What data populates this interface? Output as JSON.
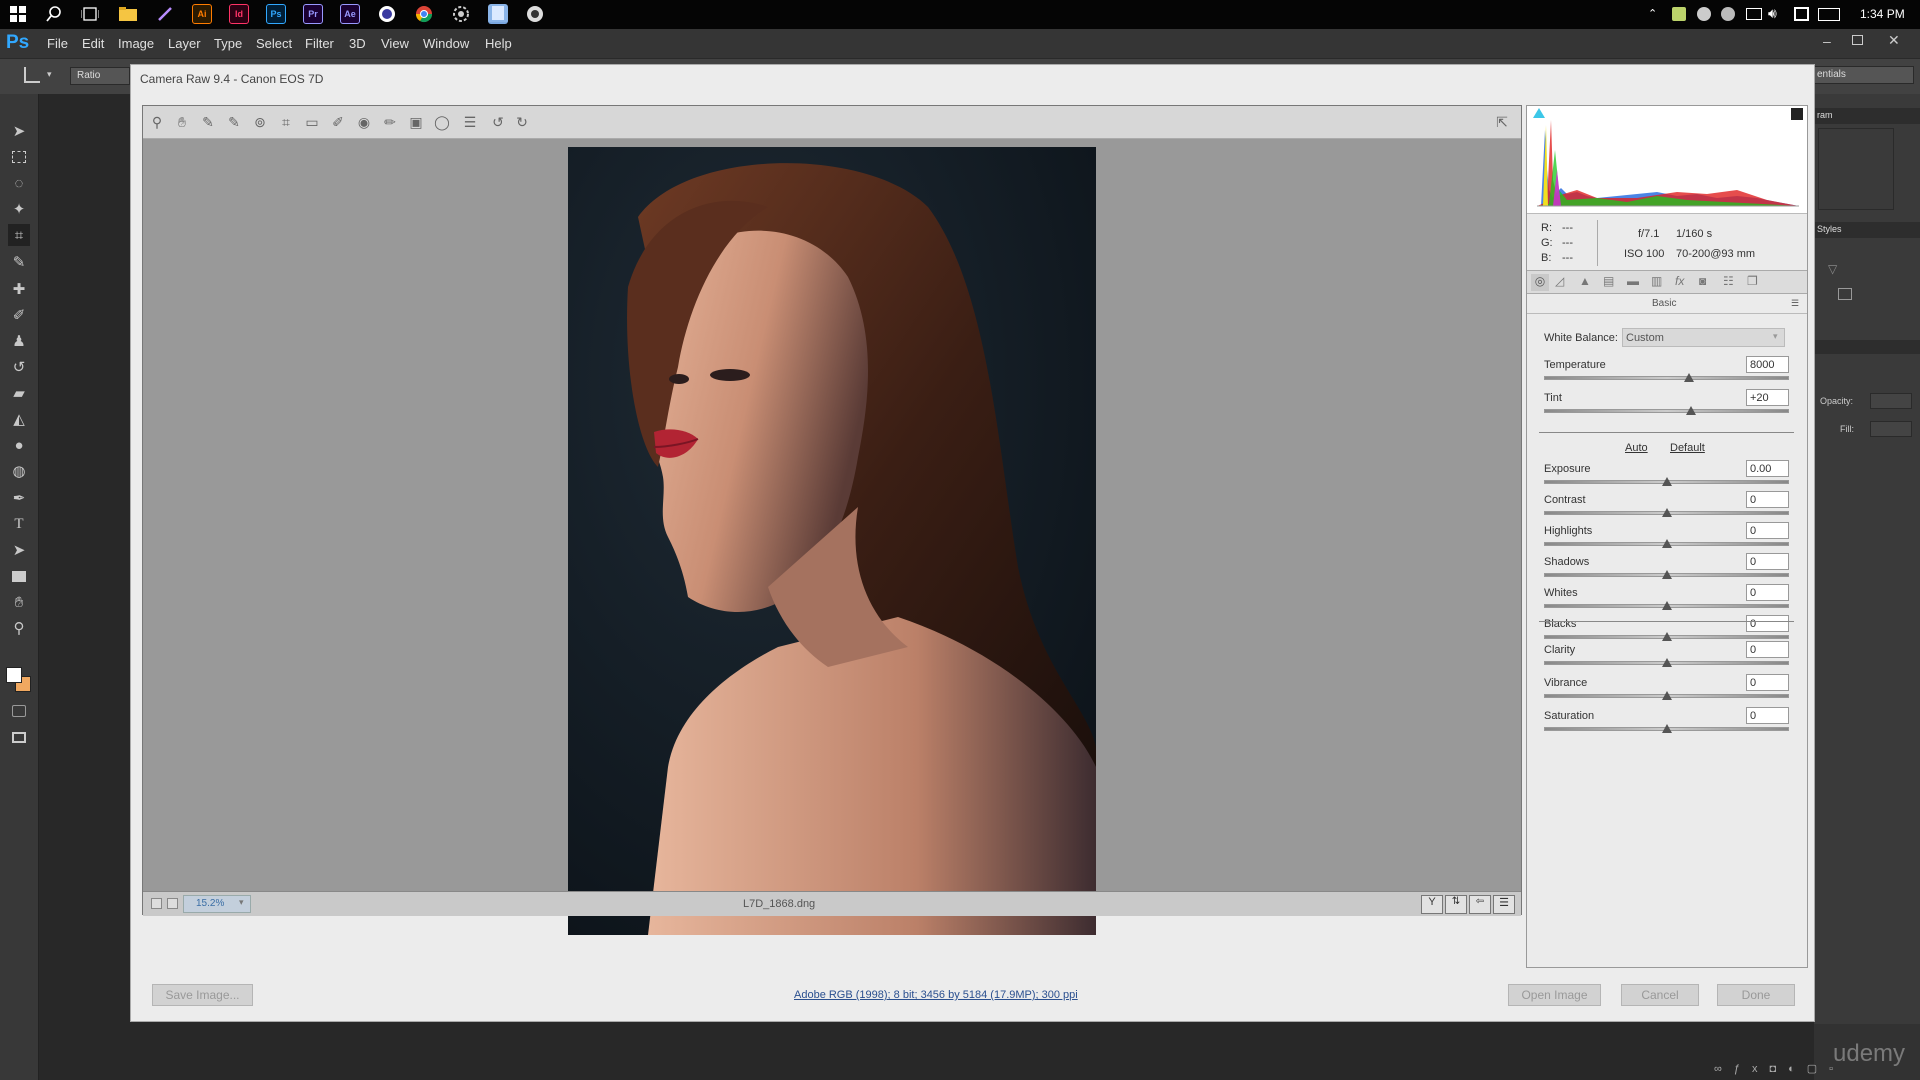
{
  "taskbar": {
    "time": "1:34 PM",
    "apps": [
      {
        "icon": "windows-start-icon",
        "label": ""
      },
      {
        "icon": "search-icon",
        "label": ""
      },
      {
        "icon": "task-view-icon",
        "label": ""
      },
      {
        "icon": "file-explorer-icon",
        "label": ""
      },
      {
        "icon": "pen-app-icon",
        "label": ""
      },
      {
        "icon": "illustrator-icon",
        "label": "Ai"
      },
      {
        "icon": "indesign-icon",
        "label": "Id"
      },
      {
        "icon": "photoshop-icon",
        "label": "Ps"
      },
      {
        "icon": "premiere-icon",
        "label": "Pr"
      },
      {
        "icon": "after-effects-icon",
        "label": "Ae"
      },
      {
        "icon": "browser-icon",
        "label": ""
      },
      {
        "icon": "chrome-icon",
        "label": ""
      },
      {
        "icon": "settings-icon",
        "label": ""
      },
      {
        "icon": "notes-icon",
        "label": ""
      },
      {
        "icon": "camera-icon",
        "label": ""
      }
    ],
    "colors": {
      "ai": "#ff7c00",
      "id": "#ff3366",
      "ps": "#31a8ff",
      "pr": "#9999ff",
      "ae": "#9999ff"
    }
  },
  "menubar": {
    "logo": "Ps",
    "items": [
      "File",
      "Edit",
      "Image",
      "Layer",
      "Type",
      "Select",
      "Filter",
      "3D",
      "View",
      "Window",
      "Help"
    ]
  },
  "options": {
    "ratio": "Ratio",
    "workspace": "entials"
  },
  "right_panel": {
    "tab1": "ram",
    "tab2": "Styles",
    "opacity": "Opacity:",
    "fill": "Fill:"
  },
  "camera_raw": {
    "title": "Camera Raw 9.4  -  Canon EOS 7D",
    "zoom": "15.2%",
    "filename": "L7D_1868.dng",
    "workflow": "Adobe RGB (1998); 8 bit; 3456 by 5184 (17.9MP); 300 ppi",
    "rgb": {
      "r_label": "R:",
      "g_label": "G:",
      "b_label": "B:",
      "r": "---",
      "g": "---",
      "b": "---"
    },
    "exif": {
      "aperture": "f/7.1",
      "shutter": "1/160 s",
      "iso": "ISO 100",
      "lens": "70-200@93 mm"
    },
    "panel_title": "Basic",
    "white_balance_label": "White Balance:",
    "white_balance_value": "Custom",
    "auto": "Auto",
    "default": "Default",
    "wb_sliders": [
      {
        "name": "Temperature",
        "value": "8000",
        "pos": 0.59
      },
      {
        "name": "Tint",
        "value": "+20",
        "pos": 0.6
      }
    ],
    "tone_sliders": [
      {
        "name": "Exposure",
        "value": "0.00",
        "pos": 0.5
      },
      {
        "name": "Contrast",
        "value": "0",
        "pos": 0.5
      },
      {
        "name": "Highlights",
        "value": "0",
        "pos": 0.5
      },
      {
        "name": "Shadows",
        "value": "0",
        "pos": 0.5
      },
      {
        "name": "Whites",
        "value": "0",
        "pos": 0.5
      },
      {
        "name": "Blacks",
        "value": "0",
        "pos": 0.5
      }
    ],
    "presence_sliders": [
      {
        "name": "Clarity",
        "value": "0",
        "pos": 0.5
      },
      {
        "name": "Vibrance",
        "value": "0",
        "pos": 0.5
      },
      {
        "name": "Saturation",
        "value": "0",
        "pos": 0.5
      }
    ],
    "buttons": {
      "save": "Save Image...",
      "open": "Open Image",
      "cancel": "Cancel",
      "done": "Done"
    }
  },
  "watermark": "udemy"
}
